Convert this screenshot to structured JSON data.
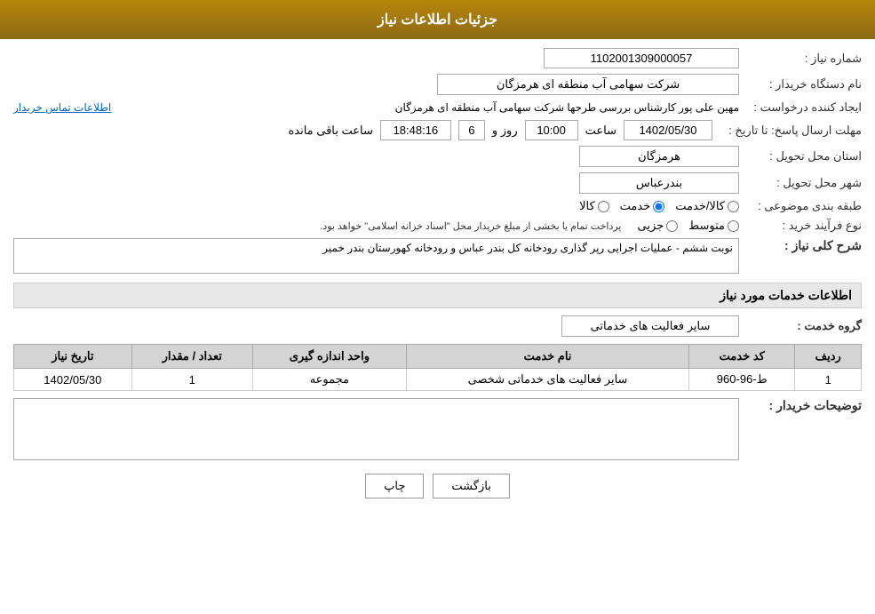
{
  "header": {
    "title": "جزئیات اطلاعات نیاز"
  },
  "fields": {
    "request_number_label": "شماره نیاز :",
    "request_number_value": "1102001309000057",
    "buyer_org_label": "نام دستگاه خریدار :",
    "buyer_org_value": "شرکت سهامی  آب منطقه ای هرمزگان",
    "creator_label": "ایجاد کننده درخواست :",
    "creator_value": "مهین علی پور کارشناس بررسی طرحها شرکت سهامی  آب منطقه ای هرمزگان",
    "contact_link": "اطلاعات تماس خریدار",
    "deadline_label": "مهلت ارسال پاسخ: تا تاریخ :",
    "deadline_date": "1402/05/30",
    "deadline_time_label": "ساعت",
    "deadline_time": "10:00",
    "deadline_day_label": "روز و",
    "deadline_days": "6",
    "deadline_remaining_label": "ساعت باقی مانده",
    "deadline_remaining": "18:48:16",
    "province_label": "استان محل تحویل :",
    "province_value": "هرمزگان",
    "city_label": "شهر محل تحویل :",
    "city_value": "بندرعباس",
    "category_label": "طبقه بندی موضوعی :",
    "category_options": [
      "کالا",
      "خدمت",
      "کالا/خدمت"
    ],
    "category_selected": "خدمت",
    "process_label": "نوع فرآیند خرید :",
    "process_options": [
      "جزیی",
      "متوسط"
    ],
    "process_note": "پرداخت تمام یا بخشی از مبلغ خریدار محل \"اسناد خزانه اسلامی\" خواهد بود.",
    "description_label": "شرح کلی نیاز :",
    "description_value": "نوبت ششم - عملیات اجرایی رپر گذاری رودخانه کل بندر عباس و رودخانه کهورستان بندر خمیر",
    "services_section": "اطلاعات خدمات مورد نیاز",
    "service_group_label": "گروه خدمت :",
    "service_group_value": "سایر فعالیت های خدماتی",
    "table": {
      "headers": [
        "ردیف",
        "کد خدمت",
        "نام خدمت",
        "واحد اندازه گیری",
        "تعداد / مقدار",
        "تاریخ نیاز"
      ],
      "rows": [
        {
          "row": "1",
          "code": "ط-96-960",
          "name": "سایر فعالیت های خدماتی شخصی",
          "unit": "مجموعه",
          "quantity": "1",
          "date": "1402/05/30"
        }
      ]
    },
    "buyer_desc_label": "توضیحات خریدار :",
    "buyer_desc_value": ""
  },
  "buttons": {
    "print": "چاپ",
    "back": "بازگشت"
  }
}
